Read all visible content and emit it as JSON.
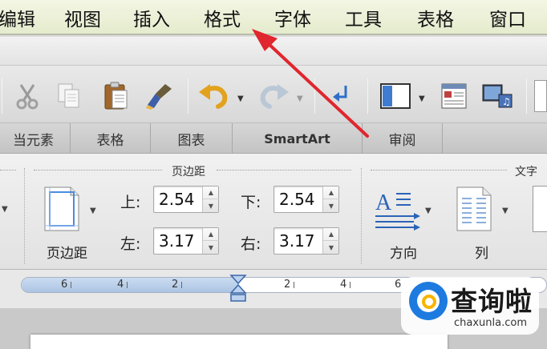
{
  "menu": {
    "items": [
      "编辑",
      "视图",
      "插入",
      "格式",
      "字体",
      "工具",
      "表格",
      "窗口"
    ]
  },
  "toolbar": {
    "icons": [
      "cut-icon",
      "copy-icon",
      "paste-icon",
      "format-painter-icon",
      "undo-icon",
      "redo-icon",
      "paragraph-return-icon",
      "sidebar-icon",
      "gallery-icon",
      "media-browser-icon"
    ]
  },
  "ribbon_tabs": [
    "当元素",
    "表格",
    "图表",
    "SmartArt",
    "审阅"
  ],
  "ribbon": {
    "margins_group_title": "页边距",
    "text_group_title": "文字",
    "top_label": "上:",
    "top_value": "2.54",
    "bottom_label": "下:",
    "bottom_value": "2.54",
    "left_label": "左:",
    "left_value": "3.17",
    "right_label": "右:",
    "right_value": "3.17",
    "margins_button": "页边距",
    "direction_button": "方向",
    "columns_button": "列"
  },
  "ruler": {
    "numbers": [
      "6",
      "4",
      "2",
      "2",
      "4",
      "6"
    ]
  },
  "watermark": {
    "brand": "查询啦",
    "url": "chaxunla.com"
  },
  "colors": {
    "menubar": "#e9eed6",
    "arrow": "#e0262e",
    "ruler_blue": "#b6cbe8",
    "watermark_blue": "#1d7be0",
    "watermark_yellow": "#f7b500"
  }
}
